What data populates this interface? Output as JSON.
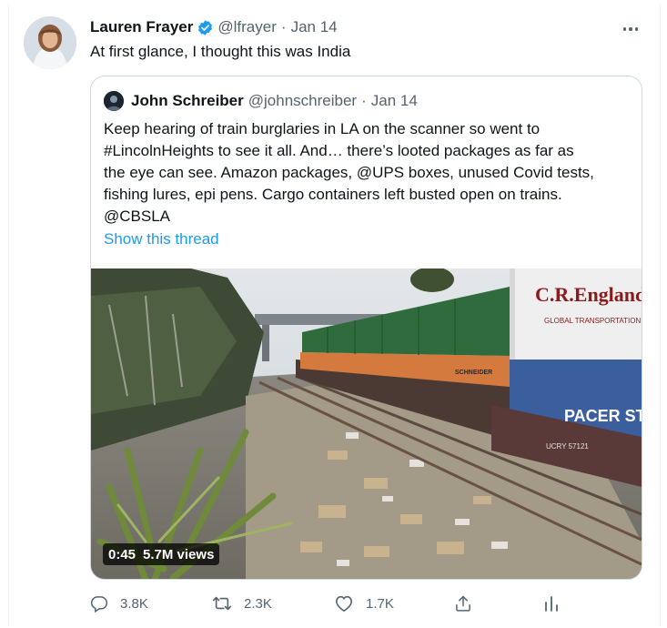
{
  "tweet": {
    "author_name": "Lauren Frayer",
    "author_handle": "@lfrayer",
    "separator": "·",
    "date": "Jan 14",
    "text": "At first glance, I thought this was India",
    "verified": true
  },
  "quoted_tweet": {
    "author_name": "John Schreiber",
    "author_handle": "@johnschreiber",
    "separator": "·",
    "date": "Jan 14",
    "text_lines": [
      "Keep hearing of train burglaries in LA on the scanner so went to",
      "#LincolnHeights to see it all. And… there’s looted packages as far as",
      "the eye can see. Amazon packages, @UPS boxes, unused Covid tests,",
      "fishing lures, epi pens. Cargo containers left busted open on trains.",
      "@CBSLA"
    ],
    "show_thread_label": "Show this thread",
    "video": {
      "duration": "0:45",
      "views": "5.7M views",
      "container_texts": [
        "C.R.England",
        "GLOBAL TRANSPORTATION",
        "PACER STACK",
        "SCHNEIDER",
        "UCRY 57121"
      ]
    }
  },
  "actions": {
    "replies": "3.8K",
    "retweets": "2.3K",
    "likes": "1.7K"
  },
  "colors": {
    "accent": "#1d9bf0",
    "muted": "#536471",
    "text": "#0f1419",
    "border": "#cfd9de"
  },
  "icons": {
    "verified": "verified-badge-icon",
    "more": "more-icon",
    "reply": "reply-icon",
    "retweet": "retweet-icon",
    "like": "heart-icon",
    "share": "share-icon",
    "analytics": "analytics-icon"
  }
}
